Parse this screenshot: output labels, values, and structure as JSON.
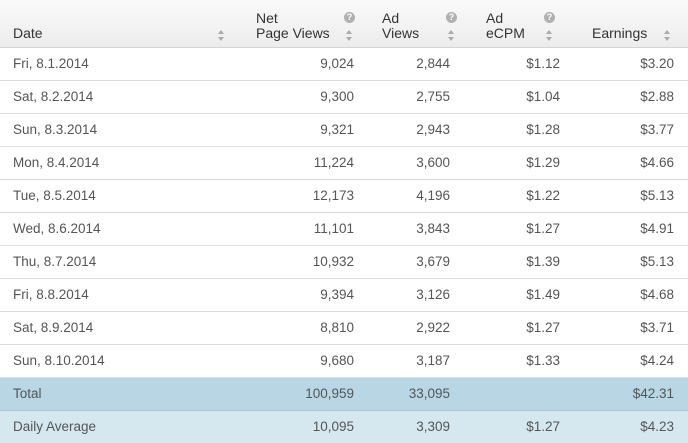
{
  "headers": {
    "date": "Date",
    "net_page_views": [
      "Net",
      "Page Views"
    ],
    "ad_views": [
      "Ad",
      "Views"
    ],
    "ad_ecpm": [
      "Ad",
      "eCPM"
    ],
    "earnings": "Earnings"
  },
  "help_glyph": "?",
  "rows": [
    {
      "date": "Fri, 8.1.2014",
      "pv": "9,024",
      "av": "2,844",
      "ecpm": "$1.12",
      "earn": "$3.20"
    },
    {
      "date": "Sat, 8.2.2014",
      "pv": "9,300",
      "av": "2,755",
      "ecpm": "$1.04",
      "earn": "$2.88"
    },
    {
      "date": "Sun, 8.3.2014",
      "pv": "9,321",
      "av": "2,943",
      "ecpm": "$1.28",
      "earn": "$3.77"
    },
    {
      "date": "Mon, 8.4.2014",
      "pv": "11,224",
      "av": "3,600",
      "ecpm": "$1.29",
      "earn": "$4.66"
    },
    {
      "date": "Tue, 8.5.2014",
      "pv": "12,173",
      "av": "4,196",
      "ecpm": "$1.22",
      "earn": "$5.13"
    },
    {
      "date": "Wed, 8.6.2014",
      "pv": "11,101",
      "av": "3,843",
      "ecpm": "$1.27",
      "earn": "$4.91"
    },
    {
      "date": "Thu, 8.7.2014",
      "pv": "10,932",
      "av": "3,679",
      "ecpm": "$1.39",
      "earn": "$5.13"
    },
    {
      "date": "Fri, 8.8.2014",
      "pv": "9,394",
      "av": "3,126",
      "ecpm": "$1.49",
      "earn": "$4.68"
    },
    {
      "date": "Sat, 8.9.2014",
      "pv": "8,810",
      "av": "2,922",
      "ecpm": "$1.27",
      "earn": "$3.71"
    },
    {
      "date": "Sun, 8.10.2014",
      "pv": "9,680",
      "av": "3,187",
      "ecpm": "$1.33",
      "earn": "$4.24"
    }
  ],
  "total": {
    "label": "Total",
    "pv": "100,959",
    "av": "33,095",
    "ecpm": "",
    "earn": "$42.31"
  },
  "average": {
    "label": "Daily Average",
    "pv": "10,095",
    "av": "3,309",
    "ecpm": "$1.27",
    "earn": "$4.23"
  }
}
